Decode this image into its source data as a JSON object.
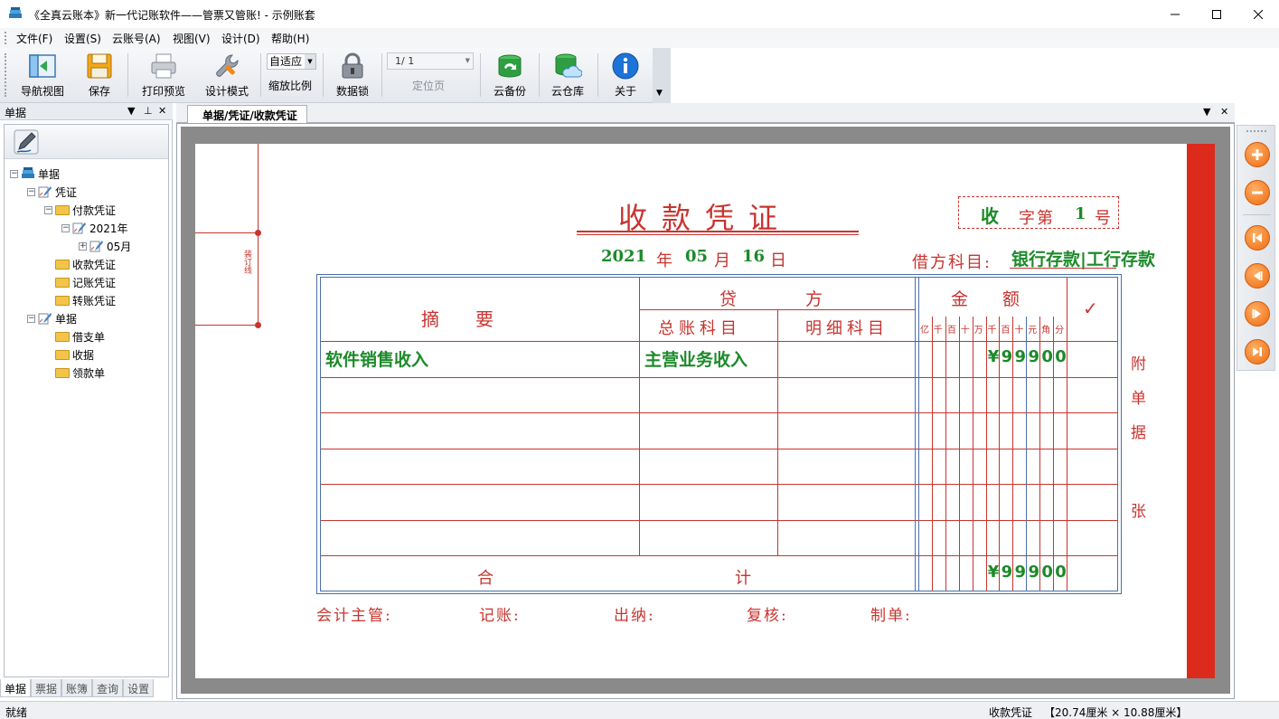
{
  "window": {
    "title": "《全真云账本》新一代记账软件——管票又管账!  - 示例账套",
    "controls": [
      "minimize",
      "maximize",
      "close"
    ]
  },
  "menu": [
    "文件(F)",
    "设置(S)",
    "云账号(A)",
    "视图(V)",
    "设计(D)",
    "帮助(H)"
  ],
  "toolbar": {
    "nav_view": "导航视图",
    "save": "保存",
    "print_preview": "打印预览",
    "design_mode": "设计模式",
    "zoom_value": "自适应",
    "zoom_label": "缩放比例",
    "data_lock": "数据锁",
    "page_value": "1/ 1",
    "page_label": "定位页",
    "cloud_backup": "云备份",
    "cloud_store": "云仓库",
    "about": "关于"
  },
  "left_panel": {
    "title": "单据",
    "tree": [
      {
        "label": "单据",
        "level": 0,
        "expanded": true,
        "icon": "books-icon"
      },
      {
        "label": "凭证",
        "level": 1,
        "expanded": true,
        "icon": "voucher-icon"
      },
      {
        "label": "付款凭证",
        "level": 2,
        "expanded": true,
        "icon": "folder-icon"
      },
      {
        "label": "2021年",
        "level": 3,
        "expanded": true,
        "icon": "voucher-icon"
      },
      {
        "label": "05月",
        "level": 4,
        "expanded": false,
        "icon": "voucher-icon"
      },
      {
        "label": "收款凭证",
        "level": 2,
        "icon": "folder-icon"
      },
      {
        "label": "记账凭证",
        "level": 2,
        "icon": "folder-icon"
      },
      {
        "label": "转账凭证",
        "level": 2,
        "icon": "folder-icon"
      },
      {
        "label": "单据",
        "level": 1,
        "expanded": true,
        "icon": "voucher-icon"
      },
      {
        "label": "借支单",
        "level": 2,
        "icon": "folder-icon"
      },
      {
        "label": "收据",
        "level": 2,
        "icon": "folder-icon"
      },
      {
        "label": "领款单",
        "level": 2,
        "icon": "folder-icon"
      }
    ],
    "tabs": [
      "单据",
      "票据",
      "账簿",
      "查询",
      "设置"
    ],
    "active_tab": "单据"
  },
  "document": {
    "tab_label": "单据/凭证/收款凭证",
    "voucher": {
      "title": "收款凭证",
      "binding_text": "装订线",
      "no_prefix": "收",
      "no_word": "字第",
      "no_number": "1",
      "no_suffix": "号",
      "year": "2021",
      "year_unit": "年",
      "month": "05",
      "month_unit": "月",
      "day": "16",
      "day_unit": "日",
      "debit_label": "借方科目:",
      "debit_value": "银行存款|工行存款",
      "header": {
        "summary": "摘　　要",
        "credit": "贷　　　　方",
        "general_account": "总账科目",
        "detail_account": "明细科目",
        "amount": "金　　额",
        "check": "✓",
        "digits": [
          "亿",
          "千",
          "百",
          "十",
          "万",
          "千",
          "百",
          "十",
          "元",
          "角",
          "分"
        ]
      },
      "rows": [
        {
          "summary": "软件销售收入",
          "general_account": "主营业务收入",
          "detail_account": "",
          "amount": "¥99900"
        },
        {
          "summary": "",
          "general_account": "",
          "detail_account": "",
          "amount": ""
        },
        {
          "summary": "",
          "general_account": "",
          "detail_account": "",
          "amount": ""
        },
        {
          "summary": "",
          "general_account": "",
          "detail_account": "",
          "amount": ""
        },
        {
          "summary": "",
          "general_account": "",
          "detail_account": "",
          "amount": ""
        },
        {
          "summary": "",
          "general_account": "",
          "detail_account": "",
          "amount": ""
        }
      ],
      "total_label_1": "合",
      "total_label_2": "计",
      "total_amount": "¥99900",
      "attachment": [
        "附",
        "单",
        "据",
        "张"
      ],
      "signatures": [
        "会计主管:",
        "记账:",
        "出纳:",
        "复核:",
        "制单:"
      ]
    }
  },
  "side_buttons": [
    "zoom-in-icon",
    "zoom-out-icon",
    "first-page-icon",
    "prev-page-icon",
    "next-page-icon",
    "last-page-icon"
  ],
  "status": {
    "left": "就绪",
    "doc_name": "收款凭证",
    "size": "【20.74厘米 × 10.88厘米】"
  },
  "colors": {
    "voucher_red": "#c8342f",
    "voucher_green": "#1c8a2a",
    "table_blue": "#4a6fa5",
    "accent_orange": "#ee6a10"
  }
}
